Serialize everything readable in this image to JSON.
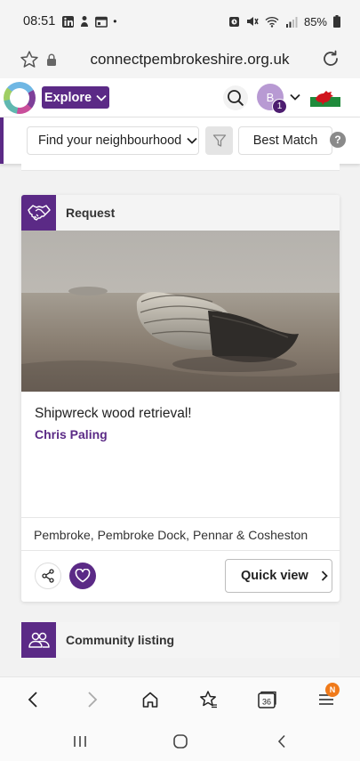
{
  "status_bar": {
    "time": "08:51",
    "dot": "•",
    "battery": "85%",
    "icons": [
      "linkedin-icon",
      "app-icon",
      "calendar-icon",
      "alarm-icon",
      "mute-icon",
      "wifi-icon",
      "signal-icon",
      "battery-icon"
    ]
  },
  "url_bar": {
    "url": "connectpembrokeshire.org.uk"
  },
  "header": {
    "explore_label": "Explore",
    "avatar_initial": "B",
    "avatar_badge": "1"
  },
  "filters": {
    "neighbourhood_label": "Find your neighbourhood",
    "sort_label": "Best Match",
    "help_label": "?"
  },
  "listing": {
    "type_label": "Request",
    "title": "Shipwreck wood retrieval!",
    "author": "Chris Paling",
    "location": "Pembroke, Pembroke Dock, Pennar & Cosheston",
    "quick_view_label": "Quick view"
  },
  "listing2": {
    "type_label": "Community listing"
  },
  "browser_toolbar": {
    "tabs_count": "36",
    "menu_badge": "N"
  },
  "colors": {
    "brand_purple": "#5b2a86",
    "badge_orange": "#f07a1a"
  }
}
